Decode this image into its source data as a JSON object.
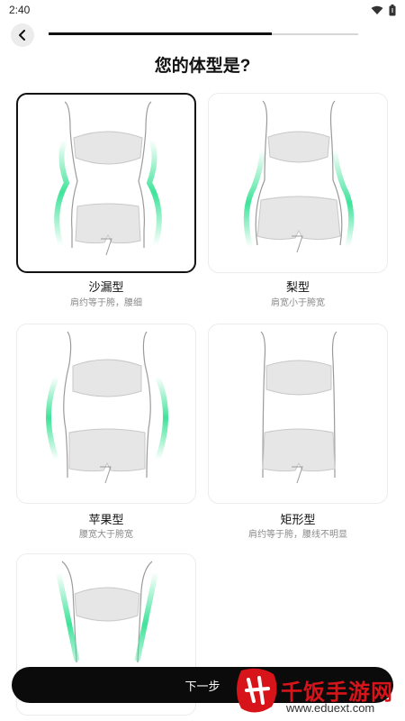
{
  "status_bar": {
    "time": "2:40"
  },
  "onboarding": {
    "progress": 0.72
  },
  "page": {
    "title": "您的体型是?"
  },
  "options": [
    {
      "id": "hourglass",
      "title": "沙漏型",
      "desc": "肩约等于胯，腰细",
      "selected": true
    },
    {
      "id": "pear",
      "title": "梨型",
      "desc": "肩宽小于胯宽",
      "selected": false
    },
    {
      "id": "apple",
      "title": "苹果型",
      "desc": "腰宽大于胯宽",
      "selected": false
    },
    {
      "id": "rectangle",
      "title": "矩形型",
      "desc": "肩约等于胯，腰线不明显",
      "selected": false
    },
    {
      "id": "inverted-triangle",
      "title": "",
      "desc": "",
      "selected": false
    }
  ],
  "footer": {
    "next_label": "下一步"
  },
  "watermark": {
    "name": "千饭手游网",
    "url": "www.eduext.com"
  },
  "colors": {
    "accent": "#3fe39a",
    "primary": "#0b0b0b",
    "brand": "#d8141b"
  }
}
